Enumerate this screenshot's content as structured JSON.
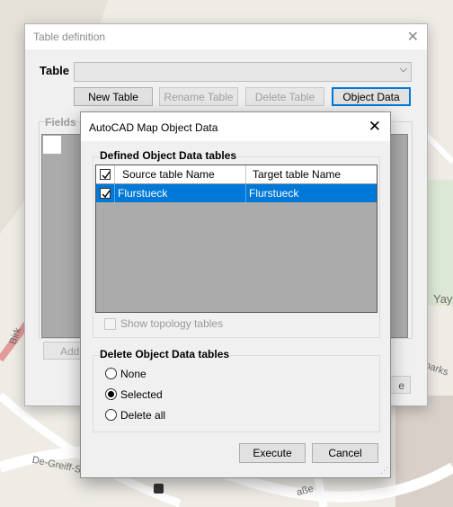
{
  "map": {
    "labels": [
      "Birk",
      "Yay",
      "estparks",
      "De-Greiff-Straße",
      "aße"
    ]
  },
  "outer_dialog": {
    "title": "Table definition",
    "table_label": "Table",
    "table_value": "",
    "buttons": {
      "new_table": "New Table",
      "rename_table": "Rename Table",
      "delete_table": "Delete Table",
      "object_data": "Object Data"
    },
    "fields_label": "Fields",
    "add_button": "Add",
    "right_button": "e"
  },
  "inner_dialog": {
    "title": "AutoCAD Map Object Data",
    "defined_group": "Defined Object Data tables",
    "columns": [
      "Source table Name",
      "Target table Name"
    ],
    "rows": [
      {
        "checked": true,
        "source": "Flurstueck",
        "target": "Flurstueck"
      }
    ],
    "show_topology": "Show topology tables",
    "delete_group": "Delete Object Data tables",
    "delete_options": [
      "None",
      "Selected",
      "Delete all"
    ],
    "delete_selected": "Selected",
    "execute": "Execute",
    "cancel": "Cancel"
  },
  "colors": {
    "selection": "#0078d7",
    "grid_bg": "#ababab",
    "dialog_bg": "#f0f0f0"
  }
}
